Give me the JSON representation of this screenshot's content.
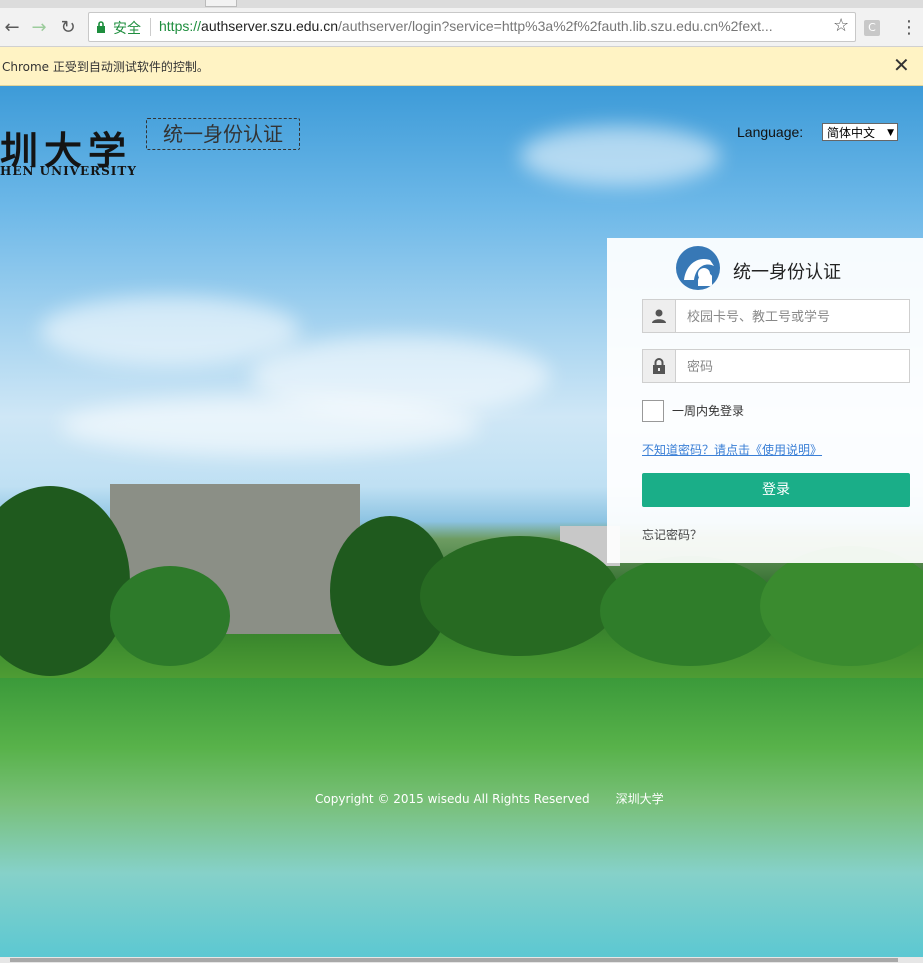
{
  "browser": {
    "secure_label": "安全",
    "url_scheme": "https://",
    "url_host": "authserver.szu.edu.cn",
    "url_path": "/authserver/login?service=http%3a%2f%2fauth.lib.szu.edu.cn%2fext...",
    "extension_label": "C",
    "infobar_message": "Chrome 正受到自动测试软件的控制。",
    "icons": [
      "back-arrow-icon",
      "forward-arrow-icon",
      "reload-icon",
      "lock-icon",
      "star-icon",
      "extension-icon",
      "kebab-menu-icon",
      "close-icon"
    ]
  },
  "header": {
    "logo_cn": "圳大学",
    "logo_en": "HEN UNIVERSITY",
    "logo_title": "统一身份认证",
    "language_label": "Language:",
    "language_selected": "简体中文"
  },
  "login": {
    "title": "统一身份认证",
    "username_placeholder": "校园卡号、教工号或学号",
    "password_placeholder": "密码",
    "remember_label": "一周内免登录",
    "help_link": "不知道密码？请点击《使用说明》",
    "login_button": "登录",
    "forgot_password": "忘记密码？",
    "button_color": "#1aae88"
  },
  "footer": {
    "copyright": "Copyright © 2015 wisedu All Rights Reserved",
    "university": "深圳大学"
  }
}
